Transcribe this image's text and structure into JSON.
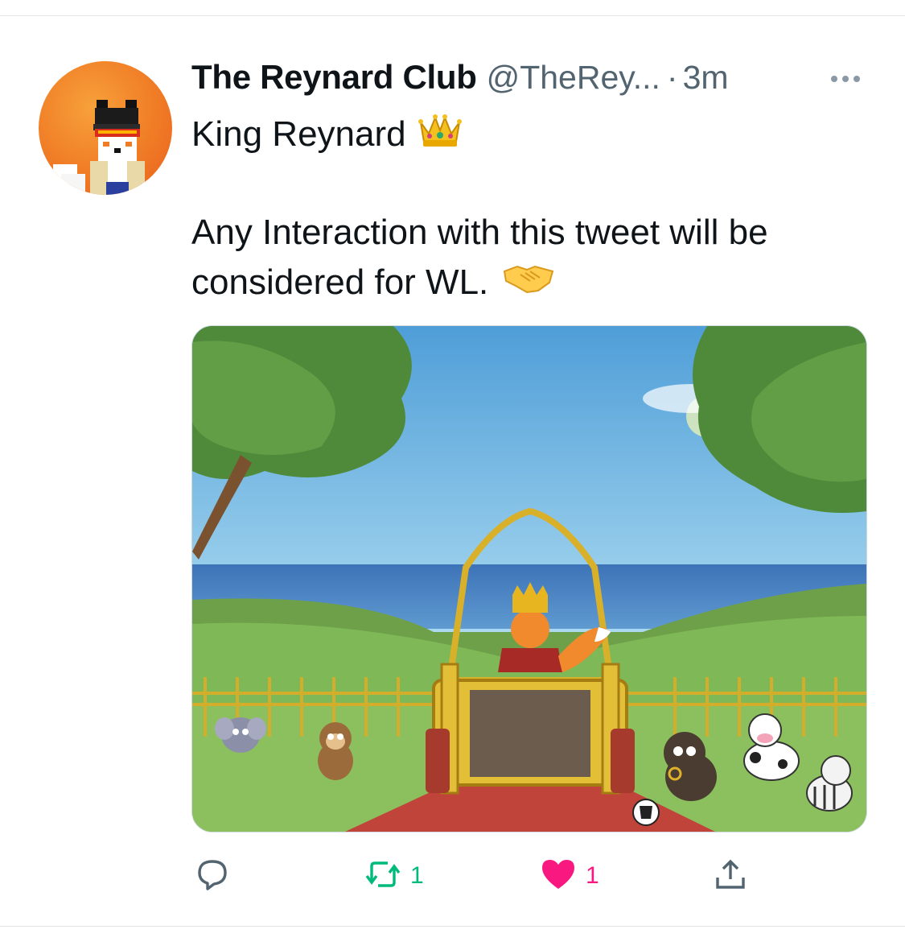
{
  "tweet": {
    "author_name": "The Reynard Club",
    "handle": "@TheRey...",
    "separator": "·",
    "time": "3m",
    "line1": "King Reynard",
    "line1_emoji": "crown",
    "body_line1": "Any Interaction with this tweet will be",
    "body_line2": "considered for WL.",
    "body_emoji": "handshake"
  },
  "media": {
    "description_icons": [
      "tree-icon",
      "throne-icon",
      "fox-king-icon",
      "cow-icon",
      "bull-icon",
      "zebra-icon",
      "monkey-icon",
      "elephant-icon",
      "ball-icon"
    ]
  },
  "actions": {
    "reply_count": "",
    "retweet_count": "1",
    "like_count": "1"
  },
  "colors": {
    "retweet_active": "#00ba7c",
    "like_active": "#f91880",
    "secondary_text": "#536471",
    "avatar_bg": "#f07c26"
  }
}
